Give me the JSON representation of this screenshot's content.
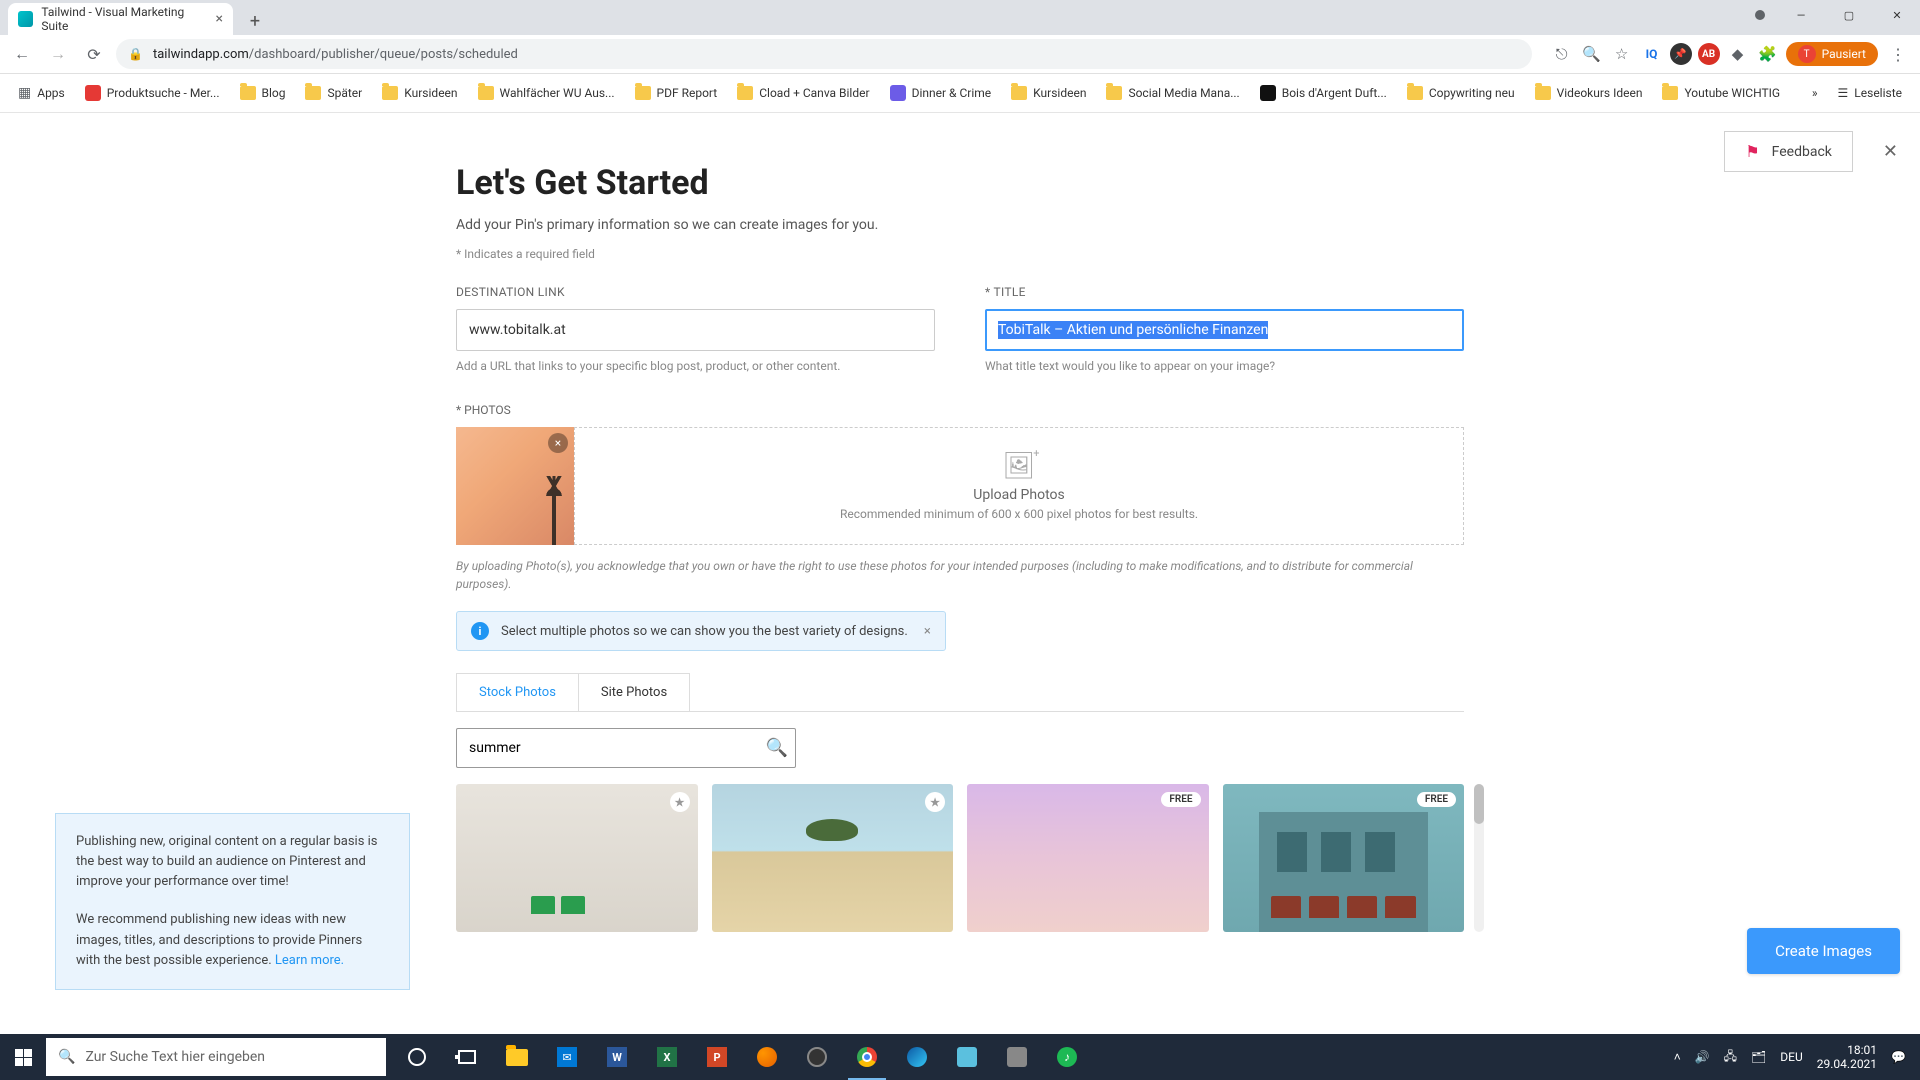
{
  "browser": {
    "tab_title": "Tailwind - Visual Marketing Suite",
    "url_host": "tailwindapp.com",
    "url_path": "/dashboard/publisher/queue/posts/scheduled",
    "profile_label": "Pausiert",
    "bookmarks": [
      "Apps",
      "Produktsuche - Mer...",
      "Blog",
      "Später",
      "Kursideen",
      "Wahlfächer WU Aus...",
      "PDF Report",
      "Cload + Canva Bilder",
      "Dinner & Crime",
      "Kursideen",
      "Social Media Mana...",
      "Bois d'Argent Duft...",
      "Copywriting neu",
      "Videokurs Ideen",
      "Youtube WICHTIG"
    ],
    "bookmarks_readinglist": "Leseliste"
  },
  "page": {
    "feedback": "Feedback",
    "heading": "Let's Get Started",
    "subtitle": "Add your Pin's primary information so we can create images for you.",
    "required_note": "* Indicates a required field",
    "dest_label": "DESTINATION LINK",
    "dest_value": "www.tobitalk.at",
    "dest_helper": "Add a URL that links to your specific blog post, product, or other content.",
    "title_label": "* TITLE",
    "title_value": "TobiTalk – Aktien und persönliche Finanzen",
    "title_helper": "What title text would you like to appear on your image?",
    "photos_label": "* PHOTOS",
    "upload_title": "Upload Photos",
    "upload_sub": "Recommended minimum of 600 x 600 pixel photos for best results.",
    "disclaimer": "By uploading Photo(s), you acknowledge that you own or have the right to use these photos for your intended purposes (including to make modifications, and to distribute for commercial purposes).",
    "info_banner": "Select multiple photos so we can show you the best variety of designs.",
    "tab_stock": "Stock Photos",
    "tab_site": "Site Photos",
    "search_value": "summer",
    "free_badge": "FREE",
    "cta": "Create Images"
  },
  "tip": {
    "p1": "Publishing new, original content on a regular basis is the best way to build an audience on Pinterest and improve your performance over time!",
    "p2_a": "We recommend publishing new ideas with new images, titles, and descriptions to provide Pinners with the best possible experience. ",
    "p2_link": "Learn more."
  },
  "taskbar": {
    "search_placeholder": "Zur Suche Text hier eingeben",
    "lang": "DEU",
    "time": "18:01",
    "date": "29.04.2021"
  }
}
